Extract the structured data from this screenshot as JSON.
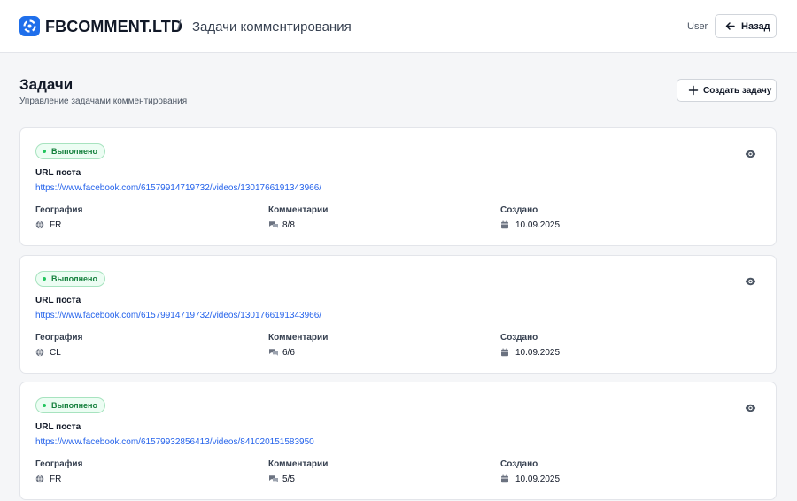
{
  "header": {
    "brand": "FBCOMMENT.LTD",
    "separator": "/",
    "breadcrumb": "Задачи комментирования",
    "user": "User",
    "back_label": "Назад"
  },
  "page": {
    "title": "Задачи",
    "subtitle": "Управление задачами комментирования",
    "create_label": "Создать задачу"
  },
  "labels": {
    "url": "URL поста",
    "geo": "География",
    "comments": "Комментарии",
    "created": "Создано"
  },
  "tasks": [
    {
      "status": "Выполнено",
      "url": "https://www.facebook.com/61579914719732/videos/1301766191343966/",
      "geo": "FR",
      "comments": "8/8",
      "created": "10.09.2025"
    },
    {
      "status": "Выполнено",
      "url": "https://www.facebook.com/61579914719732/videos/1301766191343966/",
      "geo": "CL",
      "comments": "6/6",
      "created": "10.09.2025"
    },
    {
      "status": "Выполнено",
      "url": "https://www.facebook.com/61579932856413/videos/841020151583950",
      "geo": "FR",
      "comments": "5/5",
      "created": "10.09.2025"
    }
  ],
  "colors": {
    "accent": "#1f6feb",
    "link": "#2563eb",
    "success_bg": "#ecfdf3",
    "success_text": "#15803d"
  },
  "icons": {
    "logo": "logo-icon",
    "back": "arrow-left-icon",
    "create": "plus-icon",
    "view": "eye-icon",
    "geo": "globe-icon",
    "comments": "chat-bubbles-icon",
    "created": "calendar-icon"
  }
}
